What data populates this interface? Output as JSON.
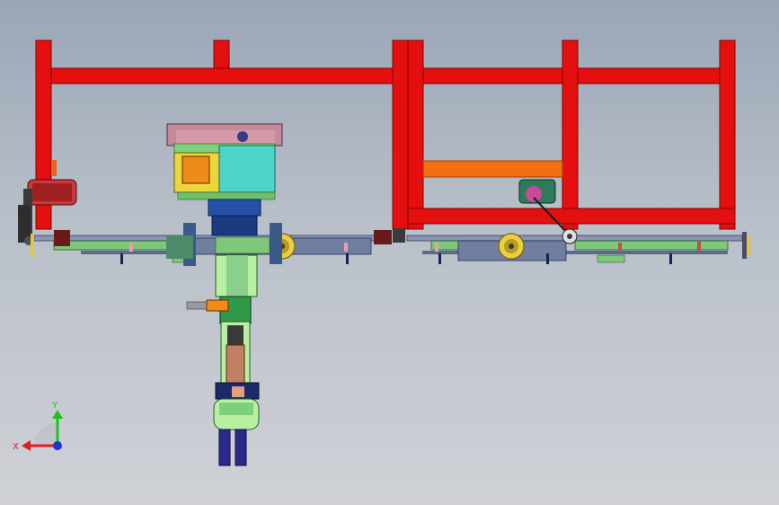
{
  "view": {
    "background_top": "#9aa6b6",
    "background_bottom": "#cfd1d6"
  },
  "triad": {
    "x_label": "X",
    "y_label": "Y",
    "x_color": "#e0201c",
    "y_color": "#20c020",
    "z_color": "#1a33d6"
  },
  "colors": {
    "frame_red": "#e3100f",
    "orange_beam": "#f46e12",
    "rail_gray": "#8a95b5",
    "rail_green": "#7ec87a",
    "yellow_block": "#ecd63a",
    "cyan_block": "#4fd5c8",
    "mauve_top": "#c28a9a",
    "blue_column": "#2450a8",
    "brown_tube": "#c08066",
    "pale_green": "#b8f0a0",
    "dark_blue": "#2a2a8a"
  }
}
